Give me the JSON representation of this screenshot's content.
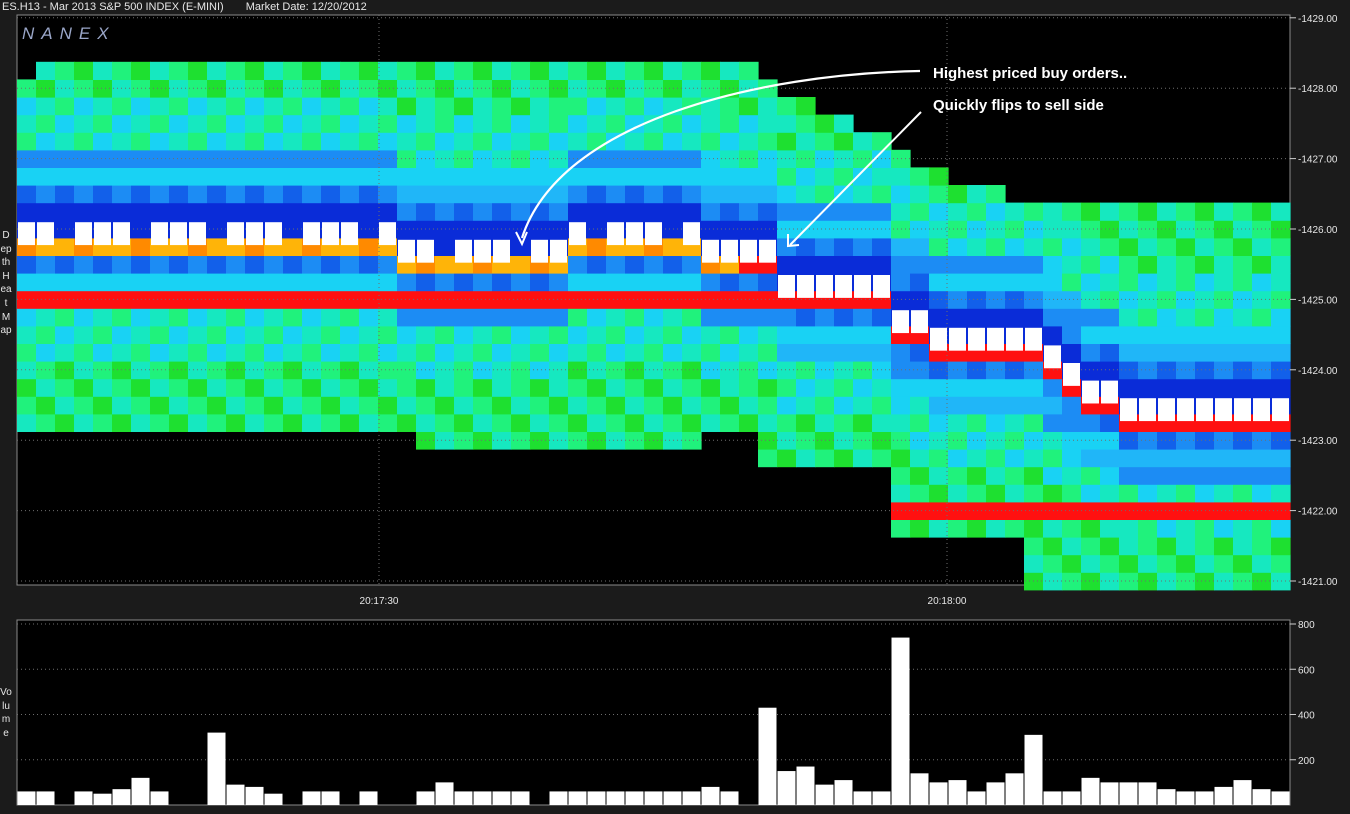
{
  "header": {
    "symbol": "ES.H13 - Mar 2013 S&P 500 INDEX (E-MINI)",
    "market_date": "Market Date: 12/20/2012"
  },
  "watermark": "NANEX",
  "side_labels": {
    "heatmap": "Depth Heat Map",
    "volume": "Volume"
  },
  "annotations": {
    "buy_orders": "Highest priced buy orders..",
    "sell_side": "Quickly flips to sell side"
  },
  "colors": {
    "background": "#000000",
    "frame": "#1b1b1b",
    "grid": "#6e6e6e",
    "bar": "#ffffff",
    "heat_scale": [
      "#0a2cd8",
      "#1260ea",
      "#1c8cf4",
      "#20b6f8",
      "#19d2f4",
      "#16e8c0",
      "#20f27c",
      "#1ee030",
      "#8ce81a",
      "#ffea10",
      "#ffb408",
      "#ff8a00",
      "#ff1010"
    ]
  },
  "chart_data": [
    {
      "type": "heatmap",
      "title": "Depth Heat Map",
      "xlabel": "",
      "ylabel": "",
      "x_ticks": [
        "20:17:30",
        "20:18:00"
      ],
      "y_ticks": [
        "1421.00",
        "1422.00",
        "1423.00",
        "1424.00",
        "1425.00",
        "1426.00",
        "1427.00",
        "1428.00",
        "1429.00"
      ],
      "ylim": [
        1420.9,
        1429.0
      ],
      "price_levels": [
        1421.0,
        1421.25,
        1421.5,
        1421.75,
        1422.0,
        1422.25,
        1422.5,
        1422.75,
        1423.0,
        1423.25,
        1423.5,
        1423.75,
        1424.0,
        1424.25,
        1424.5,
        1424.75,
        1425.0,
        1425.25,
        1425.5,
        1425.75,
        1426.0,
        1426.25,
        1426.5,
        1426.75,
        1427.0,
        1427.25,
        1427.5,
        1427.75,
        1428.0,
        1428.25
      ],
      "time_steps": 67,
      "grid": true,
      "last_trade_prices": [
        1426.0,
        1426.0,
        1426.0,
        1426.0,
        1426.0,
        1426.0,
        1426.0,
        1426.0,
        1426.0,
        1426.0,
        1426.0,
        1426.0,
        1426.0,
        1426.0,
        1426.0,
        1426.0,
        1426.0,
        1426.0,
        1426.0,
        1426.0,
        1425.75,
        1425.75,
        1425.75,
        1425.75,
        1425.75,
        1425.75,
        1425.75,
        1425.75,
        1425.75,
        1426.0,
        1426.0,
        1426.0,
        1426.0,
        1426.0,
        1426.0,
        1426.0,
        1425.75,
        1425.75,
        1425.75,
        1425.75,
        1425.25,
        1425.25,
        1425.25,
        1425.25,
        1425.25,
        1425.25,
        1424.75,
        1424.75,
        1424.5,
        1424.5,
        1424.5,
        1424.5,
        1424.5,
        1424.5,
        1424.25,
        1424.0,
        1423.75,
        1423.75,
        1423.5,
        1423.5,
        1423.5,
        1423.5,
        1423.5,
        1423.5,
        1423.5,
        1423.5,
        1423.5
      ]
    },
    {
      "type": "bar",
      "title": "Volume",
      "ylabel": "",
      "y_ticks": [
        "200",
        "400",
        "600",
        "800"
      ],
      "ylim": [
        0,
        800
      ],
      "grid": true,
      "values": [
        60,
        60,
        0,
        60,
        50,
        70,
        120,
        60,
        0,
        0,
        320,
        90,
        80,
        50,
        0,
        60,
        60,
        0,
        60,
        0,
        0,
        60,
        100,
        60,
        60,
        60,
        60,
        0,
        60,
        60,
        60,
        60,
        60,
        60,
        60,
        60,
        80,
        60,
        0,
        430,
        150,
        170,
        90,
        110,
        60,
        60,
        740,
        140,
        100,
        110,
        60,
        100,
        140,
        310,
        60,
        60,
        120,
        100,
        100,
        100,
        70,
        60,
        60,
        80,
        110,
        70,
        60
      ]
    }
  ]
}
